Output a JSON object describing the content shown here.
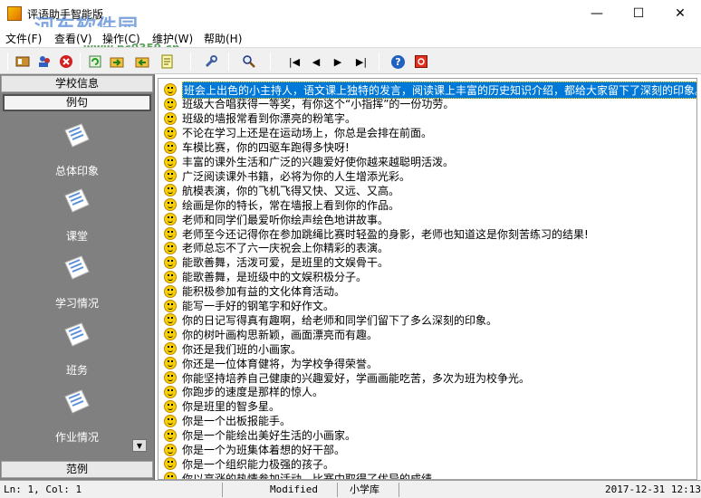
{
  "window": {
    "title": "评语助手智能版",
    "controls": {
      "minimize": "—",
      "maximize": "☐",
      "close": "✕"
    }
  },
  "watermark": {
    "logo": "河东软件园",
    "url": "www.pc0359.cn"
  },
  "menubar": {
    "items": [
      {
        "label": "文件(F)"
      },
      {
        "label": "查看(V)"
      },
      {
        "label": "操作(C)"
      },
      {
        "label": "维护(W)"
      },
      {
        "label": "帮助(H)"
      }
    ]
  },
  "toolbar": {
    "buttons": [
      {
        "icon": "open-book-icon"
      },
      {
        "icon": "people-icon"
      },
      {
        "icon": "delete-icon"
      },
      {
        "icon": "refresh-icon"
      },
      {
        "icon": "import-icon"
      },
      {
        "icon": "export-icon"
      },
      {
        "icon": "note-icon"
      },
      {
        "icon": "tools-icon"
      },
      {
        "icon": "search-icon"
      },
      {
        "icon": "first-record-icon",
        "glyph": "|◀"
      },
      {
        "icon": "previous-record-icon",
        "glyph": "◀"
      },
      {
        "icon": "next-record-icon",
        "glyph": "▶"
      },
      {
        "icon": "last-record-icon",
        "glyph": "▶|"
      },
      {
        "icon": "help-icon",
        "glyph": "?"
      },
      {
        "icon": "stop-icon"
      }
    ]
  },
  "leftpanel": {
    "section_header": "学校信息",
    "active_item": "例句",
    "footer_header": "范例",
    "items": [
      {
        "label": "总体印象"
      },
      {
        "label": "课堂"
      },
      {
        "label": "学习情况"
      },
      {
        "label": "班务"
      },
      {
        "label": "作业情况"
      }
    ],
    "scroll_glyph": "▼"
  },
  "comments": [
    "班会上出色的小主持人，语文课上独特的发言，阅读课上丰富的历史知识介绍，都给大家留下了深刻的印象。",
    "班级大合唱获得一等奖，有你这个“小指挥”的一份功劳。",
    "班级的墙报常看到你漂亮的粉笔字。",
    "不论在学习上还是在运动场上，你总是会排在前面。",
    "车模比赛，你的四驱车跑得多快呀!",
    "丰富的课外生活和广泛的兴趣爱好使你越来越聪明活泼。",
    "广泛阅读课外书籍，必将为你的人生增添光彩。",
    "航模表演，你的飞机飞得又快、又远、又高。",
    "绘画是你的特长，常在墙报上看到你的作品。",
    "老师和同学们最爱听你绘声绘色地讲故事。",
    "老师至今还记得你在参加跳绳比赛时轻盈的身影，老师也知道这是你刻苦练习的结果!",
    "老师总忘不了六一庆祝会上你精彩的表演。",
    "能歌善舞，活泼可爱，是班里的文娱骨干。",
    "能歌善舞，是班级中的文娱积极分子。",
    "能积极参加有益的文化体育活动。",
    "能写一手好的钢笔字和好作文。",
    "你的日记写得真有趣啊，给老师和同学们留下了多么深刻的印象。",
    "你的树叶画构思新颖，画面漂亮而有趣。",
    "你还是我们班的小画家。",
    "你还是一位体育健将，为学校争得荣誉。",
    "你能坚持培养自己健康的兴趣爱好，学画画能吃苦，多次为班为校争光。",
    "你跑步的速度是那样的惊人。",
    "你是班里的智多星。",
    "你是一个出板报能手。",
    "你是一个能绘出美好生活的小画家。",
    "你是一个为班集体着想的好干部。",
    "你是一个组织能力极强的孩子。",
    "你以高涨的热情参加活动，比赛中取得了优异的成绩。"
  ],
  "selected_index": 0,
  "statusbar": {
    "position": "Ln: 1, Col: 1",
    "state": "Modified",
    "library": "小学库",
    "datetime": "2017-12-31 12:13"
  },
  "colors": {
    "selection": "#0078d7",
    "left_panel": "#808080",
    "smiley": "#f8d000"
  }
}
